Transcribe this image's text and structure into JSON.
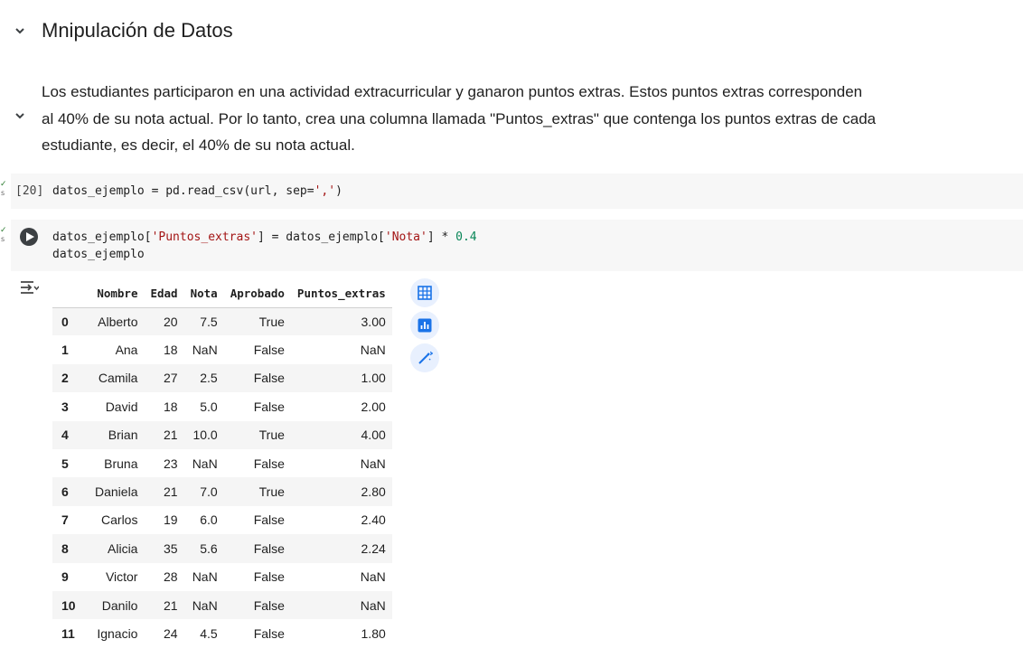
{
  "section": {
    "title": "Mnipulación de Datos"
  },
  "markdown": {
    "lines": [
      "Los estudiantes participaron en una actividad extracurricular y ganaron puntos extras. Estos puntos extras corresponden",
      "al 40% de su nota actual. Por lo tanto, crea una columna llamada \"Puntos_extras\" que contenga los puntos extras de cada",
      "estudiante, es decir, el 40% de su nota actual."
    ]
  },
  "cells": [
    {
      "exec_count": "[20]",
      "status_tick": "✓",
      "status_sub": "s",
      "code_parts": [
        "datos_ejemplo = pd.read_csv(url, sep=",
        "','",
        ")"
      ]
    },
    {
      "status_tick": "✓",
      "status_sub": "s",
      "code_line1": [
        "datos_ejemplo[",
        "'Puntos_extras'",
        "] = datos_ejemplo[",
        "'Nota'",
        "] * ",
        "0.4"
      ],
      "code_line2": "datos_ejemplo"
    }
  ],
  "table": {
    "columns": [
      "",
      "Nombre",
      "Edad",
      "Nota",
      "Aprobado",
      "Puntos_extras"
    ],
    "rows": [
      [
        "0",
        "Alberto",
        "20",
        "7.5",
        "True",
        "3.00"
      ],
      [
        "1",
        "Ana",
        "18",
        "NaN",
        "False",
        "NaN"
      ],
      [
        "2",
        "Camila",
        "27",
        "2.5",
        "False",
        "1.00"
      ],
      [
        "3",
        "David",
        "18",
        "5.0",
        "False",
        "2.00"
      ],
      [
        "4",
        "Brian",
        "21",
        "10.0",
        "True",
        "4.00"
      ],
      [
        "5",
        "Bruna",
        "23",
        "NaN",
        "False",
        "NaN"
      ],
      [
        "6",
        "Daniela",
        "21",
        "7.0",
        "True",
        "2.80"
      ],
      [
        "7",
        "Carlos",
        "19",
        "6.0",
        "False",
        "2.40"
      ],
      [
        "8",
        "Alicia",
        "35",
        "5.6",
        "False",
        "2.24"
      ],
      [
        "9",
        "Victor",
        "28",
        "NaN",
        "False",
        "NaN"
      ],
      [
        "10",
        "Danilo",
        "21",
        "NaN",
        "False",
        "NaN"
      ],
      [
        "11",
        "Ignacio",
        "24",
        "4.5",
        "False",
        "1.80"
      ]
    ]
  },
  "icons": {
    "collapse": "chevron-down-icon",
    "run": "play-icon",
    "output_menu": "output-actions-icon",
    "side": [
      "table-icon",
      "chart-icon",
      "magic-wand-icon"
    ]
  },
  "colors": {
    "accent": "#1a73e8",
    "cell_bg": "#f7f7f7",
    "string": "#a31515",
    "number": "#098658"
  }
}
